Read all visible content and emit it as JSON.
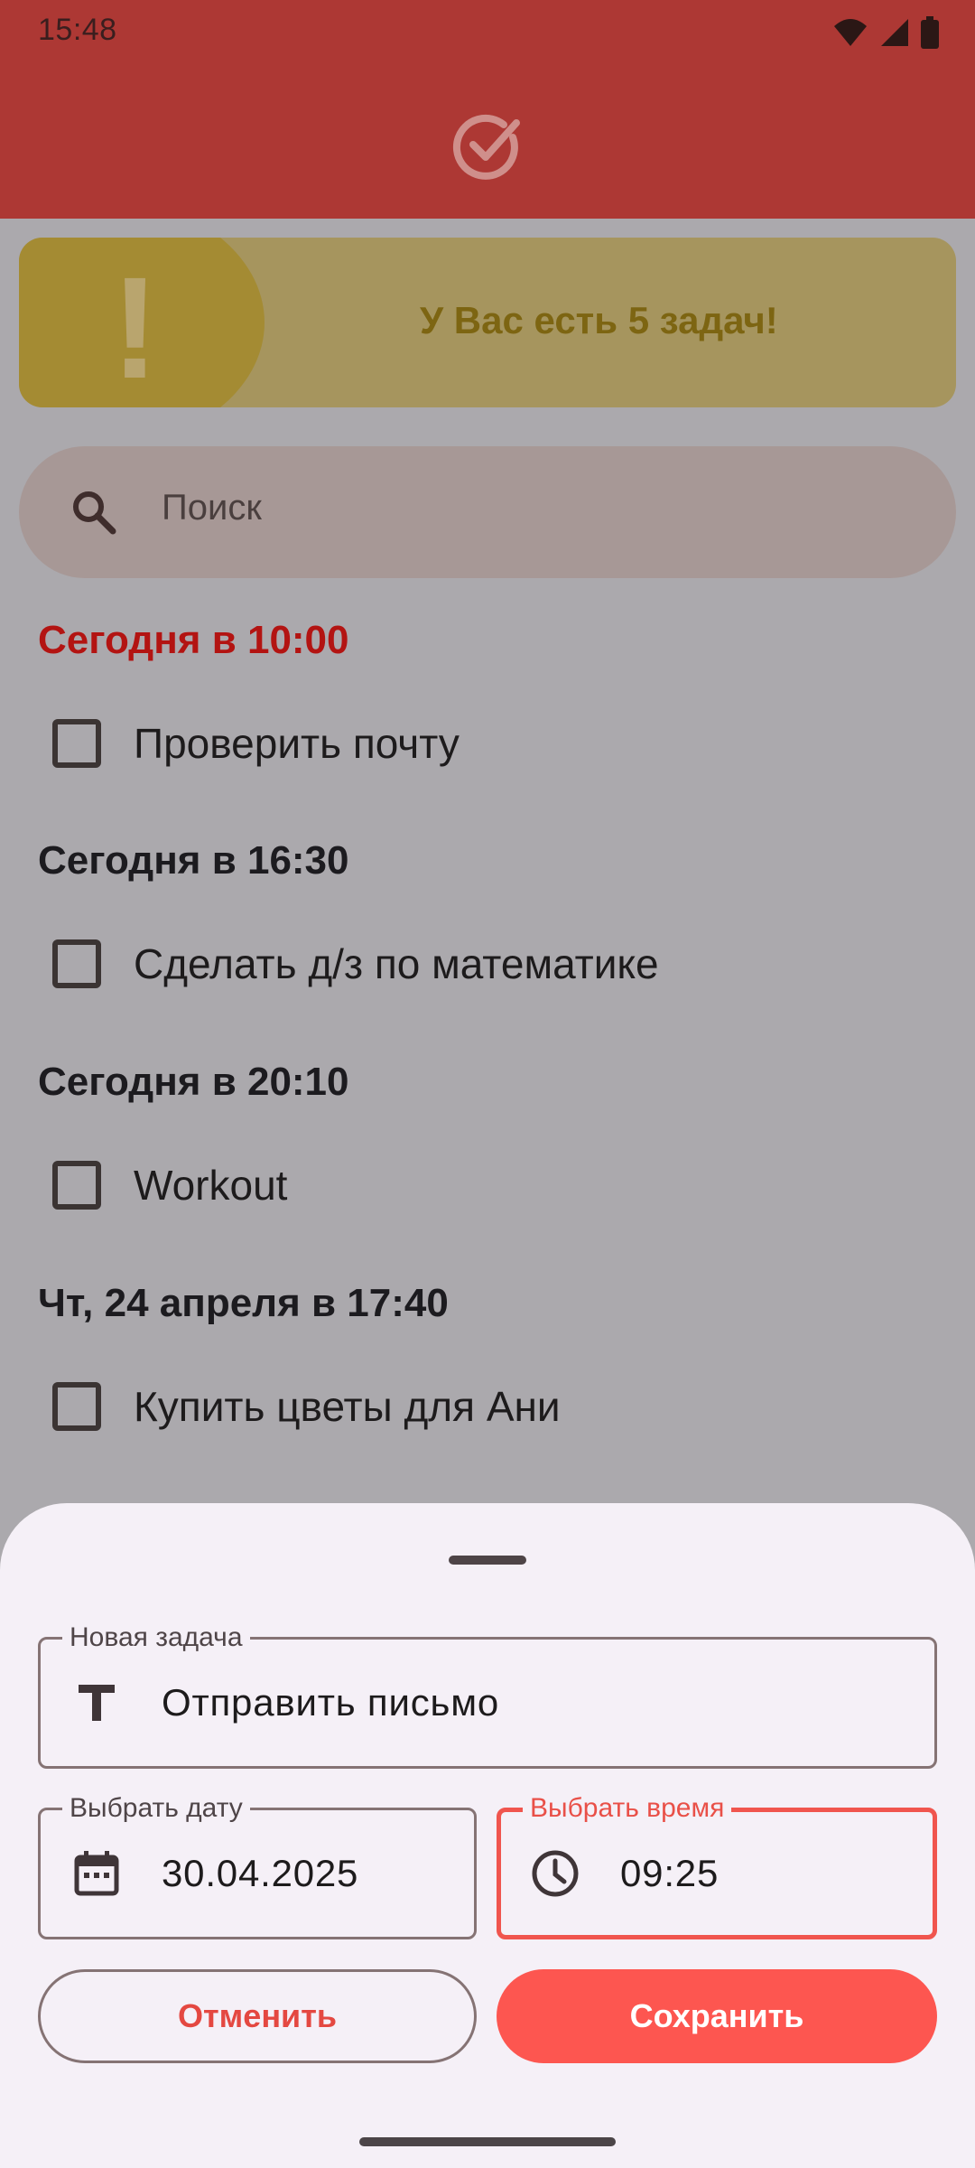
{
  "status_bar": {
    "time": "15:48"
  },
  "banner": {
    "icon": "exclamation-icon",
    "text": "У Вас есть 5 задач!"
  },
  "search": {
    "placeholder": "Поиск",
    "icon": "search-icon"
  },
  "task_groups": [
    {
      "header": "Сегодня в 10:00",
      "overdue": true,
      "tasks": [
        {
          "title": "Проверить почту",
          "checked": false
        }
      ]
    },
    {
      "header": "Сегодня в 16:30",
      "overdue": false,
      "tasks": [
        {
          "title": "Сделать д/з по математике",
          "checked": false
        }
      ]
    },
    {
      "header": "Сегодня в 20:10",
      "overdue": false,
      "tasks": [
        {
          "title": "Workout",
          "checked": false
        }
      ]
    },
    {
      "header": "Чт, 24 апреля в 17:40",
      "overdue": false,
      "tasks": [
        {
          "title": "Купить цветы для Ани",
          "checked": false
        }
      ]
    }
  ],
  "sheet": {
    "task_field": {
      "label": "Новая задача",
      "value": "Отправить письмо",
      "icon": "text-format-icon"
    },
    "date_field": {
      "label": "Выбрать дату",
      "value": "30.04.2025",
      "icon": "calendar-icon"
    },
    "time_field": {
      "label": "Выбрать время",
      "value": "09:25",
      "icon": "clock-icon",
      "focused": true
    },
    "cancel_label": "Отменить",
    "save_label": "Сохранить"
  },
  "colors": {
    "accent": "#fd5650",
    "overdue": "#b31412",
    "appbar": "#ad3834"
  }
}
